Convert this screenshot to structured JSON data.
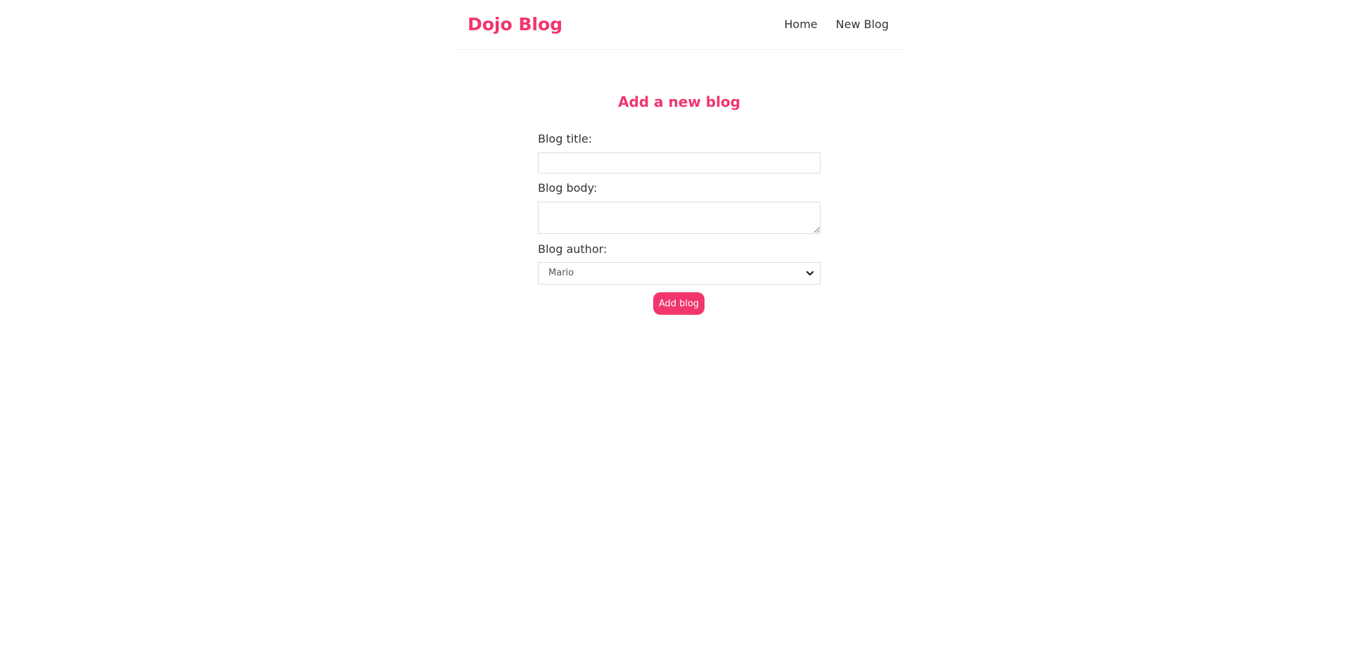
{
  "navbar": {
    "brand": "Dojo Blog",
    "links": [
      {
        "label": "Home"
      },
      {
        "label": "New Blog"
      }
    ]
  },
  "form": {
    "title": "Add a new blog",
    "fields": {
      "title_label": "Blog title:",
      "title_value": "",
      "body_label": "Blog body:",
      "body_value": "",
      "author_label": "Blog author:",
      "author_selected": "Mario"
    },
    "submit_label": "Add blog"
  },
  "colors": {
    "accent": "#f1356d",
    "text": "#333333",
    "border": "#dddddd"
  },
  "icons": {
    "select_arrow": "chevron-down-icon"
  }
}
